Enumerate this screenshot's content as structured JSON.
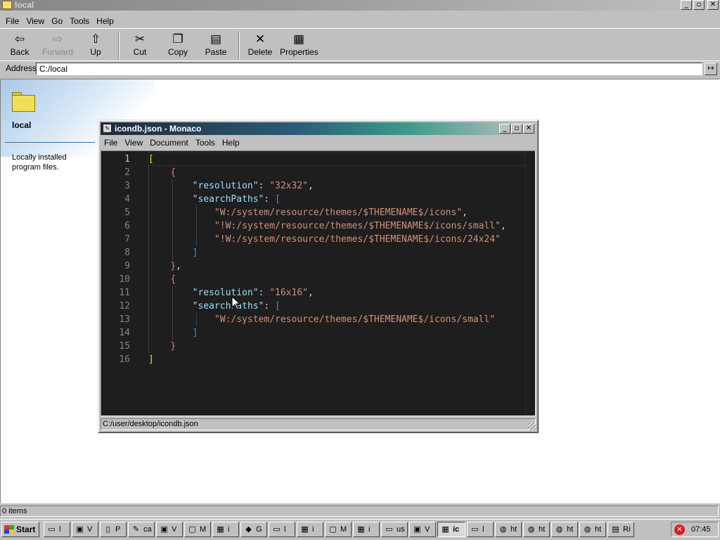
{
  "explorer": {
    "title": "local",
    "menu": [
      "File",
      "View",
      "Go",
      "Tools",
      "Help"
    ],
    "toolbar": {
      "back": "Back",
      "forward": "Forward",
      "up": "Up",
      "cut": "Cut",
      "copy": "Copy",
      "paste": "Paste",
      "delete": "Delete",
      "properties": "Properties"
    },
    "address_label": "Address",
    "address_value": "C:/local",
    "sidebar": {
      "folder_name": "local",
      "description": "Locally installed program files."
    },
    "status": "0 items"
  },
  "editor": {
    "title": "icondb.json - Monaco",
    "menu": [
      "File",
      "View",
      "Document",
      "Tools",
      "Help"
    ],
    "line_numbers": [
      "1",
      "2",
      "3",
      "4",
      "5",
      "6",
      "7",
      "8",
      "9",
      "10",
      "11",
      "12",
      "13",
      "14",
      "15",
      "16"
    ],
    "lines": [
      [
        {
          "t": "[",
          "c": "b1"
        }
      ],
      [
        {
          "t": "    ",
          "c": "p"
        },
        {
          "t": "{",
          "c": "b2"
        }
      ],
      [
        {
          "t": "        ",
          "c": "p"
        },
        {
          "t": "\"resolution\"",
          "c": "k"
        },
        {
          "t": ": ",
          "c": "p"
        },
        {
          "t": "\"32x32\"",
          "c": "s"
        },
        {
          "t": ",",
          "c": "p"
        }
      ],
      [
        {
          "t": "        ",
          "c": "p"
        },
        {
          "t": "\"searchPaths\"",
          "c": "k"
        },
        {
          "t": ": ",
          "c": "p"
        },
        {
          "t": "[",
          "c": "b3"
        }
      ],
      [
        {
          "t": "            ",
          "c": "p"
        },
        {
          "t": "\"W:/system/resource/themes/$THEMENAME$/icons\"",
          "c": "s"
        },
        {
          "t": ",",
          "c": "p"
        }
      ],
      [
        {
          "t": "            ",
          "c": "p"
        },
        {
          "t": "\"!W:/system/resource/themes/$THEMENAME$/icons/small\"",
          "c": "s"
        },
        {
          "t": ",",
          "c": "p"
        }
      ],
      [
        {
          "t": "            ",
          "c": "p"
        },
        {
          "t": "\"!W:/system/resource/themes/$THEMENAME$/icons/24x24\"",
          "c": "s"
        }
      ],
      [
        {
          "t": "        ",
          "c": "p"
        },
        {
          "t": "]",
          "c": "b3"
        }
      ],
      [
        {
          "t": "    ",
          "c": "p"
        },
        {
          "t": "}",
          "c": "b2"
        },
        {
          "t": ",",
          "c": "p"
        }
      ],
      [
        {
          "t": "    ",
          "c": "p"
        },
        {
          "t": "{",
          "c": "b2"
        }
      ],
      [
        {
          "t": "        ",
          "c": "p"
        },
        {
          "t": "\"resolution\"",
          "c": "k"
        },
        {
          "t": ": ",
          "c": "p"
        },
        {
          "t": "\"16x16\"",
          "c": "s"
        },
        {
          "t": ",",
          "c": "p"
        }
      ],
      [
        {
          "t": "        ",
          "c": "p"
        },
        {
          "t": "\"searchPaths\"",
          "c": "k"
        },
        {
          "t": ": ",
          "c": "p"
        },
        {
          "t": "[",
          "c": "b3"
        }
      ],
      [
        {
          "t": "            ",
          "c": "p"
        },
        {
          "t": "\"W:/system/resource/themes/$THEMENAME$/icons/small\"",
          "c": "s"
        }
      ],
      [
        {
          "t": "        ",
          "c": "p"
        },
        {
          "t": "]",
          "c": "b3"
        }
      ],
      [
        {
          "t": "    ",
          "c": "p"
        },
        {
          "t": "}",
          "c": "b2"
        }
      ],
      [
        {
          "t": "]",
          "c": "b1"
        }
      ]
    ],
    "status_path": "C:/user/desktop/icondb.json"
  },
  "taskbar": {
    "start_label": "Start",
    "tasks": [
      {
        "label": "l",
        "icon": "folder-icon"
      },
      {
        "label": "V",
        "icon": "terminal-icon"
      },
      {
        "label": "P",
        "icon": "document-icon"
      },
      {
        "label": "ca",
        "icon": "paint-icon"
      },
      {
        "label": "V",
        "icon": "terminal-icon"
      },
      {
        "label": "M",
        "icon": "chat-icon"
      },
      {
        "label": "i",
        "icon": "app-icon"
      },
      {
        "label": "G",
        "icon": "cube-icon"
      },
      {
        "label": "l",
        "icon": "folder-icon"
      },
      {
        "label": "i",
        "icon": "app-icon"
      },
      {
        "label": "M",
        "icon": "chat-icon"
      },
      {
        "label": "i",
        "icon": "app-icon"
      },
      {
        "label": "us",
        "icon": "folder-icon"
      },
      {
        "label": "V",
        "icon": "terminal-icon"
      },
      {
        "label": "ic",
        "icon": "app-icon",
        "active": true
      },
      {
        "label": "l",
        "icon": "folder-icon"
      },
      {
        "label": "ht",
        "icon": "globe-icon"
      },
      {
        "label": "ht",
        "icon": "globe-icon"
      },
      {
        "label": "ht",
        "icon": "globe-icon"
      },
      {
        "label": "ht",
        "icon": "globe-icon"
      },
      {
        "label": "Ri",
        "icon": "notepad-icon"
      }
    ],
    "clock": "07:45"
  }
}
